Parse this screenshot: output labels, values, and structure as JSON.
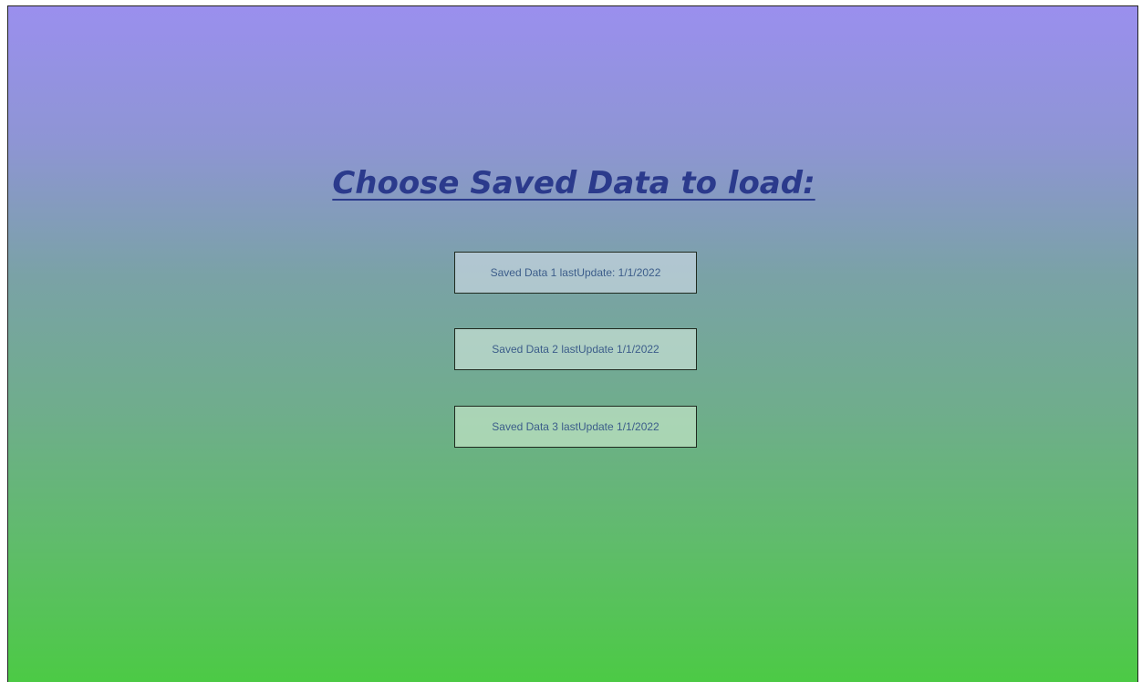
{
  "title": "Choose Saved Data to load:",
  "slots": [
    {
      "label": "Saved Data 1 lastUpdate: 1/1/2022"
    },
    {
      "label": "Saved Data 2 lastUpdate 1/1/2022"
    },
    {
      "label": "Saved Data 3 lastUpdate 1/1/2022"
    }
  ],
  "colors": {
    "gradient_top": "#9a8fee",
    "gradient_bottom": "#4cca45",
    "title": "#2b3a8c",
    "button_text": "#3c5d8a"
  }
}
